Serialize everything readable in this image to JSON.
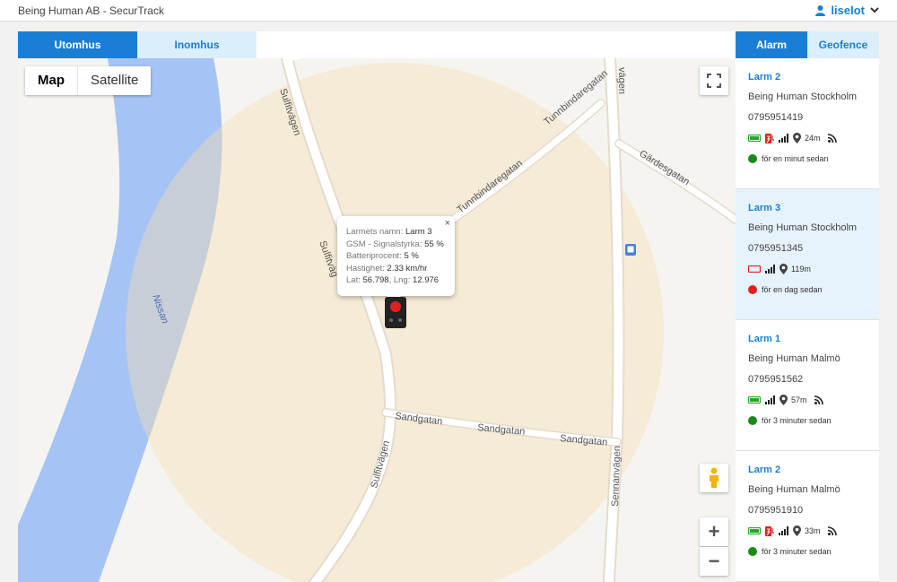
{
  "app_title": "Being Human AB - SecurTrack",
  "user": {
    "name": "liselot"
  },
  "left_tabs": [
    {
      "label": "Utomhus"
    },
    {
      "label": "Inomhus"
    }
  ],
  "right_tabs": [
    {
      "label": "Alarm"
    },
    {
      "label": "Geofence"
    }
  ],
  "map": {
    "type_buttons": {
      "map": "Map",
      "satellite": "Satellite"
    },
    "streets": {
      "sulfitvagen": "Sulfitvägen",
      "sulfitvag": "Sulfitväg",
      "tunnbindaregatan": "Tunnbindaregatan",
      "gardesgatan": "Gärdesgatan",
      "sandgatan": "Sandgatan",
      "sennanvagen": "Sennanvägen",
      "vagen": "vägen",
      "nissan": "Nissan"
    },
    "infowindow": {
      "name_label": "Larmets namn:",
      "name_value": "Larm 3",
      "gsm_label": "GSM - Signalstyrka:",
      "gsm_value": "55 %",
      "battery_label": "Batteriprocent:",
      "battery_value": "5 %",
      "speed_label": "Hastighet:",
      "speed_value": "2.33 km/hr",
      "lat_label": "Lat:",
      "lat_value": "56.798",
      "lng_label": "Lng:",
      "lng_value": "12.976",
      "close_glyph": "×"
    },
    "zoom_in_glyph": "+",
    "zoom_out_glyph": "−",
    "colors": {
      "water": "#a5c3f5",
      "geofence": "#f5deb0",
      "road": "#ffffff"
    }
  },
  "alarms": [
    {
      "name": "Larm 2",
      "org": "Being Human Stockholm",
      "phone": "0795951419",
      "distance": "24m",
      "battery": "full",
      "charging": true,
      "has_wifi": true,
      "status": "för en minut sedan",
      "status_color": "#1a8a1a",
      "selected": false
    },
    {
      "name": "Larm 3",
      "org": "Being Human Stockholm",
      "phone": "0795951345",
      "distance": "119m",
      "battery": "low",
      "charging": false,
      "has_wifi": false,
      "status": "för en dag sedan",
      "status_color": "#e02020",
      "selected": true
    },
    {
      "name": "Larm 1",
      "org": "Being Human Malmö",
      "phone": "0795951562",
      "distance": "57m",
      "battery": "full",
      "charging": false,
      "has_wifi": true,
      "status": "för 3 minuter sedan",
      "status_color": "#1a8a1a",
      "selected": false
    },
    {
      "name": "Larm 2",
      "org": "Being Human Malmö",
      "phone": "0795951910",
      "distance": "33m",
      "battery": "full",
      "charging": true,
      "has_wifi": true,
      "status": "för 3 minuter sedan",
      "status_color": "#1a8a1a",
      "selected": false
    }
  ]
}
